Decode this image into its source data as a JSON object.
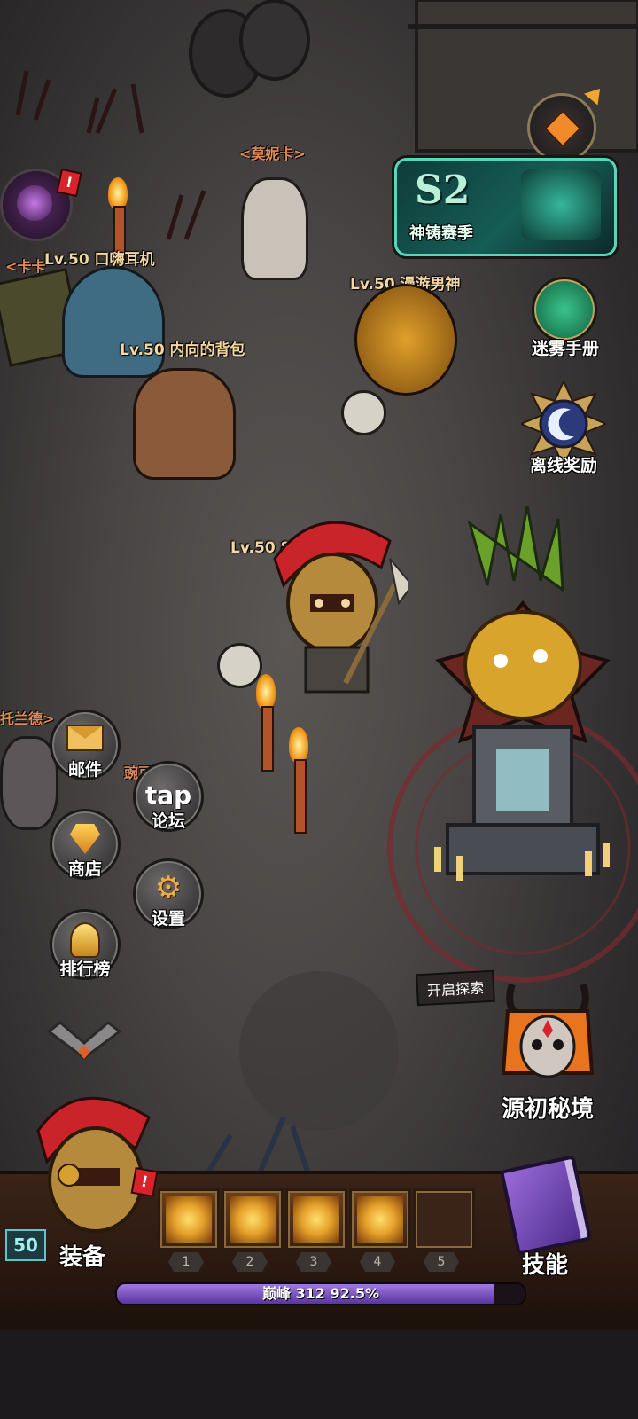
{
  "season": {
    "badge": "S2",
    "title": "神铸赛季"
  },
  "npcs": {
    "monica": "<莫妮卡>",
    "kaka": "<卡卡",
    "toland": "托兰德>",
    "wandou": "豌豆"
  },
  "players": [
    {
      "name": "Lv.50 口嗨耳机"
    },
    {
      "name": "Lv.50 漫游男神"
    },
    {
      "name": "Lv.50 内向的背包"
    },
    {
      "name": "Lv.50 80后长颈鹿"
    }
  ],
  "right_menu": {
    "manual": "迷雾手册",
    "offline": "离线奖励"
  },
  "left_menu": {
    "mail": "邮件",
    "forum_icon": "tap",
    "forum": "论坛",
    "shop": "商店",
    "settings": "设置",
    "ranking": "排行榜"
  },
  "explore": {
    "tag": "开启探索",
    "title": "源初秘境"
  },
  "hud": {
    "level": "50",
    "equip": "装备",
    "skills": "技能",
    "slots": [
      "1",
      "2",
      "3",
      "4",
      "5"
    ],
    "xp_text": "巅峰 312  92.5%",
    "xp_fraction": 0.925
  },
  "colors": {
    "accent": "#f4d7a0",
    "xp_bar": "#7a4cc4",
    "season_teal": "#39c2a6"
  },
  "icons": [
    "mail-icon",
    "tap-icon",
    "diamond-icon",
    "gear-icon",
    "trophy-icon",
    "moon-icon",
    "book-icon",
    "skull-icon",
    "alert-icon"
  ]
}
